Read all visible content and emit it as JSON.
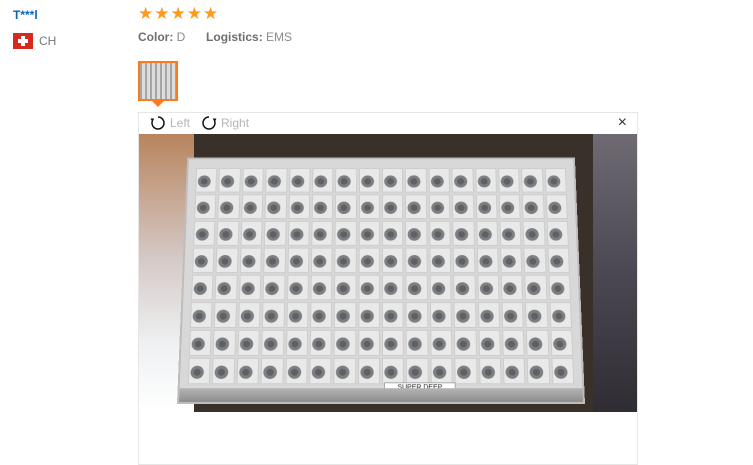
{
  "review": {
    "username": "T***l",
    "country_code": "CH",
    "rating": 5,
    "stars": [
      "★",
      "★",
      "★",
      "★",
      "★"
    ],
    "color_label": "Color:",
    "color_value": "D",
    "logistics_label": "Logistics:",
    "logistics_value": "EMS"
  },
  "viewer": {
    "rotate_left_label": "Left",
    "rotate_right_label": "Right",
    "close_glyph": "×",
    "photo_label_text": "SUPER DEEP",
    "icons": {
      "rotate_left": "rotate-left-icon",
      "rotate_right": "rotate-right-icon",
      "close": "close-icon"
    }
  },
  "colors": {
    "user_link": "#0a65b6",
    "star": "#ff9a1a",
    "thumb_border": "#ff7a1a"
  }
}
